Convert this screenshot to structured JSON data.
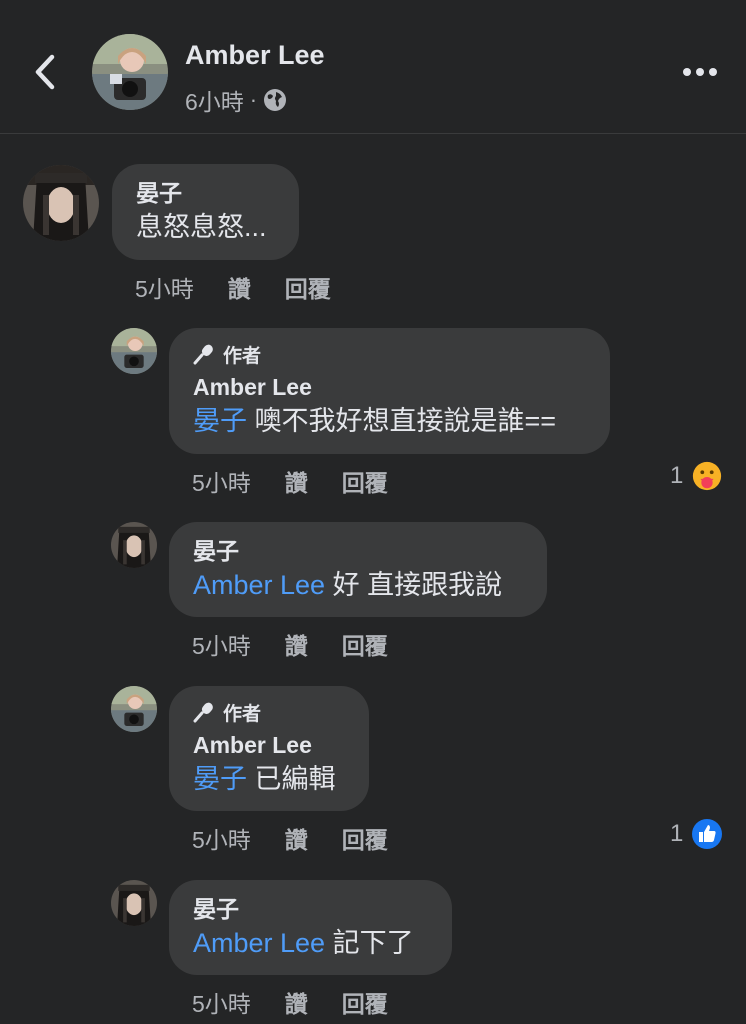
{
  "header": {
    "back_icon": "chevron-left-icon",
    "poster_name": "Amber Lee",
    "time": "6小時",
    "separator": "·",
    "privacy_icon": "globe-icon",
    "more_icon": "more-horizontal-icon"
  },
  "comments": [
    {
      "name": "晏子",
      "author_badge": "",
      "mention": "",
      "text": "息怒息怒...",
      "time": "5小時",
      "like_label": "讚",
      "reply_label": "回覆",
      "reaction_count": "",
      "reaction_icon": ""
    },
    {
      "name": "Amber Lee",
      "author_badge": "作者",
      "mention": "晏子",
      "text": " 噢不我好想直接說是誰==",
      "time": "5小時",
      "like_label": "讚",
      "reply_label": "回覆",
      "reaction_count": "1",
      "reaction_icon": "care-reaction-icon"
    },
    {
      "name": "晏子",
      "author_badge": "",
      "mention": "Amber Lee",
      "text": " 好 直接跟我說",
      "time": "5小時",
      "like_label": "讚",
      "reply_label": "回覆",
      "reaction_count": "",
      "reaction_icon": ""
    },
    {
      "name": "Amber Lee",
      "author_badge": "作者",
      "mention": "晏子",
      "text": " 已編輯",
      "time": "5小時",
      "like_label": "讚",
      "reply_label": "回覆",
      "reaction_count": "1",
      "reaction_icon": "like-reaction-icon"
    },
    {
      "name": "晏子",
      "author_badge": "",
      "mention": "Amber Lee",
      "text": " 記下了",
      "time": "5小時",
      "like_label": "讚",
      "reply_label": "回覆",
      "reaction_count": "",
      "reaction_icon": ""
    }
  ],
  "colors": {
    "background": "#242526",
    "bubble": "#3a3b3c",
    "mention": "#4f9cf8",
    "secondary_text": "#b0b3b8",
    "like_blue": "#1877f2"
  }
}
